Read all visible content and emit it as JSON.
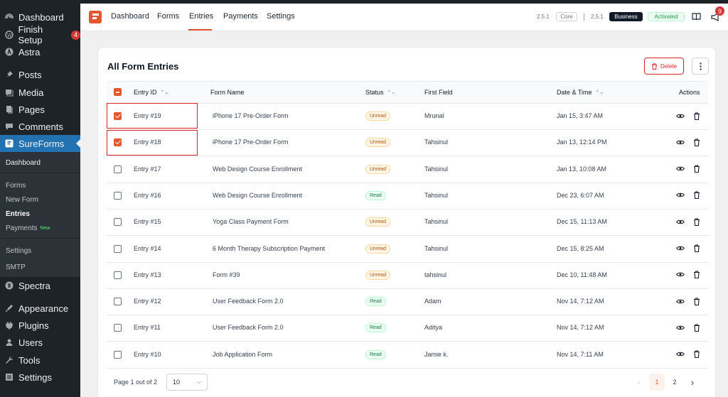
{
  "wp_sidebar": {
    "items": [
      {
        "label": "Dashboard",
        "icon": "dashboard-icon"
      },
      {
        "label": "Finish Setup",
        "icon": "wordpress-icon",
        "badge": "4"
      },
      {
        "label": "Astra",
        "icon": "astra-icon"
      },
      {
        "label": "Posts",
        "icon": "pin-icon"
      },
      {
        "label": "Media",
        "icon": "media-icon"
      },
      {
        "label": "Pages",
        "icon": "pages-icon"
      },
      {
        "label": "Comments",
        "icon": "comments-icon"
      },
      {
        "label": "SureForms",
        "icon": "sureforms-icon"
      }
    ],
    "sub_items": [
      "Dashboard",
      "Forms",
      "New Form",
      "Entries",
      "Payments",
      "Settings",
      "SMTP"
    ],
    "payments_new_tag": "New",
    "bottom_items": [
      {
        "label": "Spectra",
        "icon": "spectra-icon"
      },
      {
        "label": "Appearance",
        "icon": "appearance-icon"
      },
      {
        "label": "Plugins",
        "icon": "plugins-icon"
      },
      {
        "label": "Users",
        "icon": "users-icon"
      },
      {
        "label": "Tools",
        "icon": "tools-icon"
      },
      {
        "label": "Settings",
        "icon": "settings-icon"
      }
    ]
  },
  "topnav": {
    "links": [
      "Dashboard",
      "Forms",
      "Entries",
      "Payments",
      "Settings"
    ],
    "active": "Entries",
    "core_version": "2.5.1",
    "core_label": "Core",
    "biz_version": "2.5.1",
    "biz_label": "Business",
    "activated_label": "Activated",
    "notif_count": "9"
  },
  "main": {
    "title": "All Form Entries",
    "delete_label": "Delete",
    "columns": {
      "entry_id": "Entry ID",
      "form_name": "Form Name",
      "status": "Status",
      "first_field": "First Field",
      "date": "Date & Time",
      "actions": "Actions"
    },
    "rows": [
      {
        "id": "Entry #19",
        "form": "iPhone 17 Pre-Order Form",
        "status": "Unread",
        "first": "Mrunal",
        "date": "Jan 15, 3:47 AM",
        "checked": true
      },
      {
        "id": "Entry #18",
        "form": "iPhone 17 Pre-Order Form",
        "status": "Unread",
        "first": "Tahsinul",
        "date": "Jan 13, 12:14 PM",
        "checked": true
      },
      {
        "id": "Entry #17",
        "form": "Web Design Course Enrollment",
        "status": "Unread",
        "first": "Tahsinul",
        "date": "Jan 13, 10:08 AM",
        "checked": false
      },
      {
        "id": "Entry #16",
        "form": "Web Design Course Enrollment",
        "status": "Read",
        "first": "Tahsinul",
        "date": "Dec 23, 6:07 AM",
        "checked": false
      },
      {
        "id": "Entry #15",
        "form": "Yoga Class Payment Form",
        "status": "Unread",
        "first": "Tahsinul",
        "date": "Dec 15, 11:13 AM",
        "checked": false
      },
      {
        "id": "Entry #14",
        "form": "6 Month Therapy Subscription Payment",
        "status": "Unread",
        "first": "Tahsinul",
        "date": "Dec 15, 8:25 AM",
        "checked": false
      },
      {
        "id": "Entry #13",
        "form": "Form #39",
        "status": "Unread",
        "first": "tahsinul",
        "date": "Dec 10, 11:48 AM",
        "checked": false
      },
      {
        "id": "Entry #12",
        "form": "User Feedback Form 2.0",
        "status": "Read",
        "first": "Adam",
        "date": "Nov 14, 7:12 AM",
        "checked": false
      },
      {
        "id": "Entry #11",
        "form": "User Feedback Form 2.0",
        "status": "Read",
        "first": "Aditya",
        "date": "Nov 14, 7:12 AM",
        "checked": false
      },
      {
        "id": "Entry #10",
        "form": "Job Application Form",
        "status": "Read",
        "first": "Jamie k.",
        "date": "Nov 14, 7:11 AM",
        "checked": false
      }
    ],
    "pagination": {
      "text": "Page 1 out of 2",
      "per_page": "10",
      "pages": [
        "1",
        "2"
      ],
      "current": "1"
    }
  },
  "colors": {
    "accent": "#e4572e",
    "wp_dark": "#1d2327",
    "wp_blue": "#2271b1"
  }
}
